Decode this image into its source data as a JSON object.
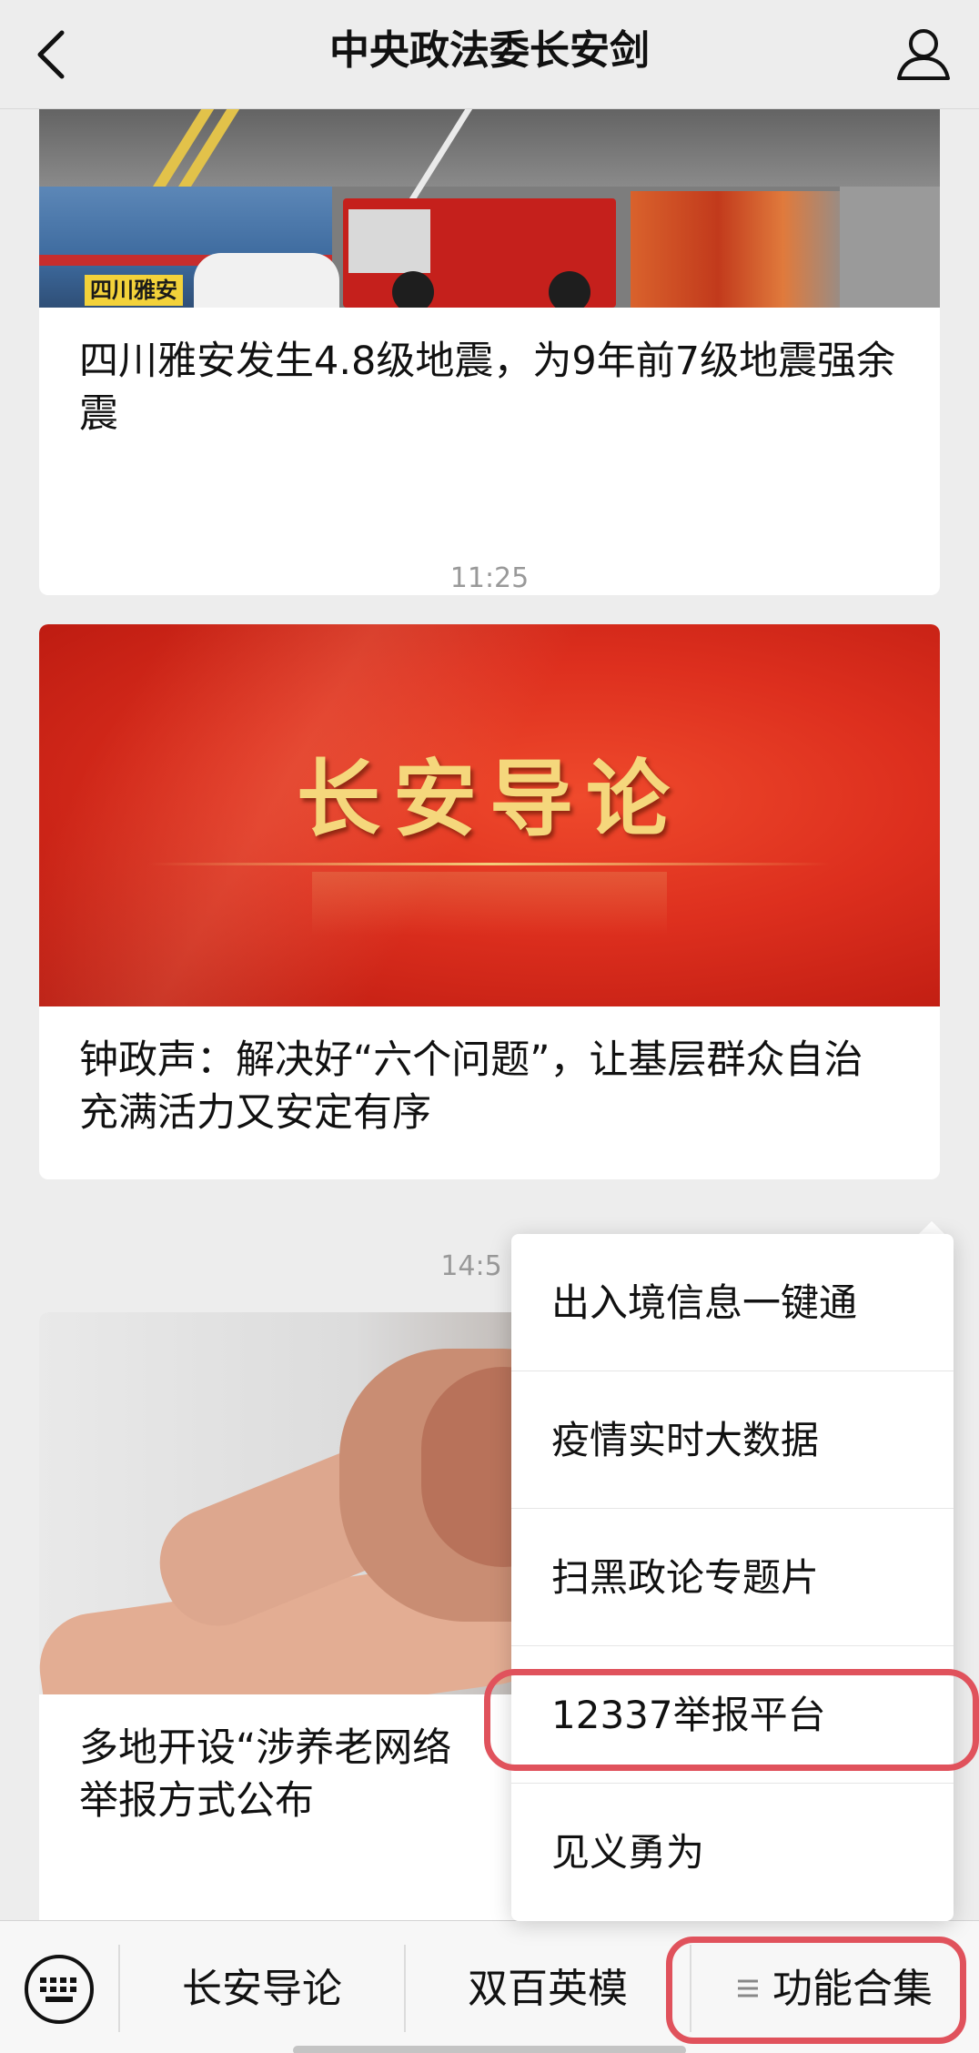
{
  "header": {
    "title": "中央政法委长安剑",
    "back_icon": "chevron-left-icon",
    "profile_icon": "person-icon"
  },
  "feed": {
    "articles": [
      {
        "image_tag": "四川雅安",
        "title": "四川雅安发生4.8级地震，为9年前7级地震强余震"
      },
      {
        "timestamp": "11:25",
        "banner_text": "长安导论",
        "title": "钟政声：解决好“六个问题”，让基层群众自治充满活力又安定有序"
      },
      {
        "timestamp": "14:5",
        "title": "多地开设“涉养老网络",
        "title_line2": "举报方式公布"
      }
    ]
  },
  "popup_menu": {
    "items": [
      "出入境信息一键通",
      "疫情实时大数据",
      "扫黑政论专题片",
      "12337举报平台",
      "见义勇为"
    ]
  },
  "bottom_bar": {
    "keyboard_icon": "keyboard-icon",
    "tabs": [
      "长安导论",
      "双百英模",
      "功能合集"
    ],
    "menu_icon": "list-icon"
  },
  "colors": {
    "highlight": "#e0525c",
    "page_bg": "#ededed",
    "banner_red": "#dd2f1e",
    "banner_gold": "#f5d77c"
  }
}
